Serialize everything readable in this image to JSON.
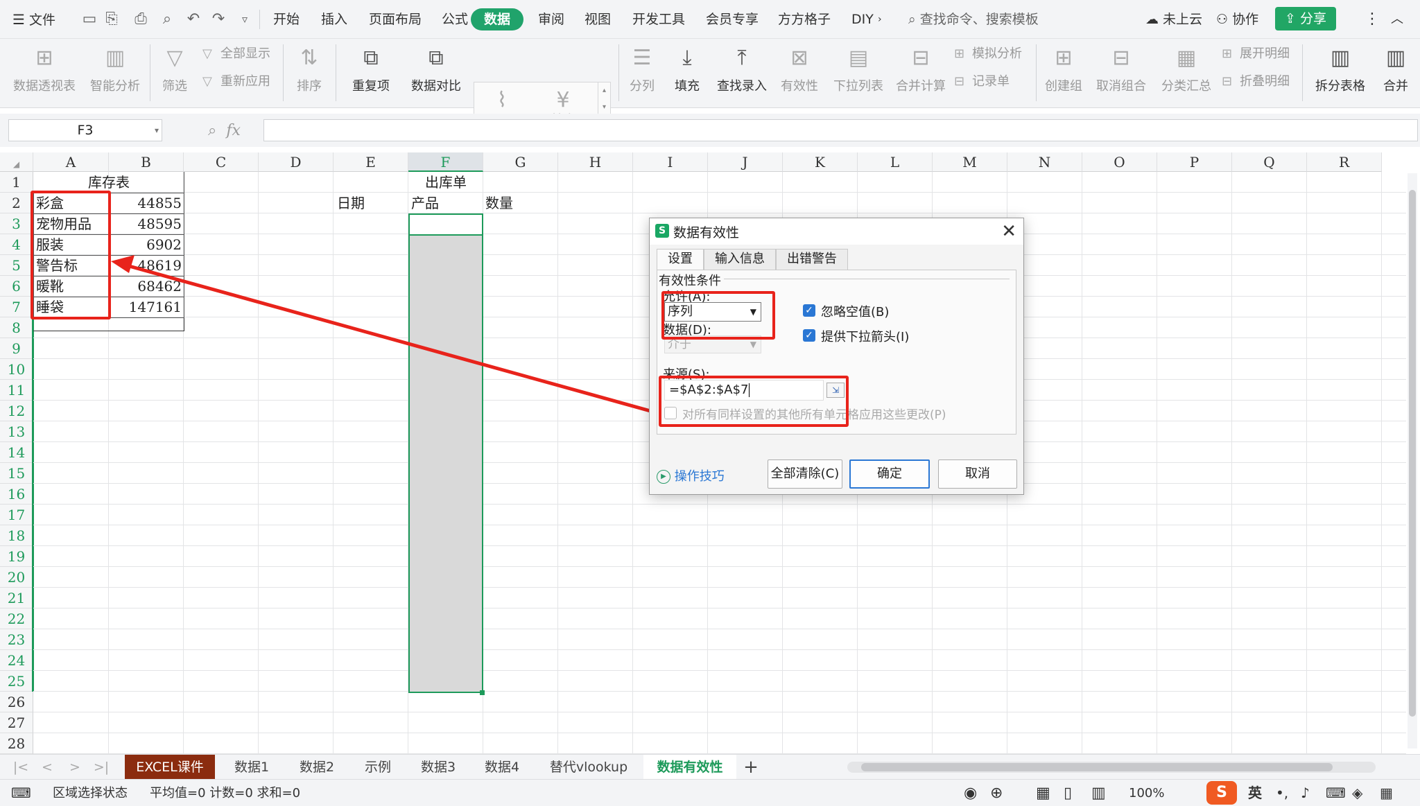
{
  "menubar": {
    "file": "文件",
    "tabs": [
      "开始",
      "插入",
      "页面布局",
      "公式",
      "数据",
      "审阅",
      "视图",
      "开发工具",
      "会员专享",
      "方方格子",
      "DIY"
    ],
    "active_tab": "数据",
    "search_placeholder": "查找命令、搜索模板",
    "cloud": "未上云",
    "collab": "协作",
    "share": "分享"
  },
  "ribbon": {
    "pivot": "数据透视表",
    "smart": "智能分析",
    "filter": "筛选",
    "show_all": "全部显示",
    "reapply": "重新应用",
    "sort": "排序",
    "duplicates": "重复项",
    "compare": "数据对比",
    "stock": "股票",
    "fund": "基金",
    "split": "分列",
    "fill": "填充",
    "lookup": "查找录入",
    "validity": "有效性",
    "dropdown": "下拉列表",
    "consolidate": "合并计算",
    "whatif": "模拟分析",
    "record": "记录单",
    "group": "创建组",
    "ungroup": "取消组合",
    "subtotal": "分类汇总",
    "expand": "展开明细",
    "collapse": "折叠明细",
    "split_table": "拆分表格",
    "merge": "合并"
  },
  "formula": {
    "namebox": "F3",
    "fx": "fx"
  },
  "grid": {
    "columns": [
      "A",
      "B",
      "C",
      "D",
      "E",
      "F",
      "G",
      "H",
      "I",
      "J",
      "K",
      "L",
      "M",
      "N",
      "O",
      "P",
      "Q",
      "R"
    ],
    "rows": [
      "1",
      "2",
      "3",
      "4",
      "5",
      "6",
      "7",
      "8",
      "9",
      "10",
      "11",
      "12",
      "13",
      "14",
      "15",
      "16",
      "17",
      "18",
      "19",
      "20",
      "21",
      "22",
      "23",
      "24",
      "25",
      "26",
      "27",
      "28"
    ],
    "inventory_title": "库存表",
    "outbound_title": "出库单",
    "header_date": "日期",
    "header_product": "产品",
    "header_qty": "数量",
    "inventory": [
      {
        "name": "彩盒",
        "qty": "44855"
      },
      {
        "name": "宠物用品",
        "qty": "48595"
      },
      {
        "name": "服装",
        "qty": "6902"
      },
      {
        "name": "警告标",
        "qty": "48619"
      },
      {
        "name": "暖靴",
        "qty": "68462"
      },
      {
        "name": "睡袋",
        "qty": "147161"
      }
    ]
  },
  "dialog": {
    "title": "数据有效性",
    "tabs": [
      "设置",
      "输入信息",
      "出错警告"
    ],
    "section": "有效性条件",
    "allow_label": "允许(A):",
    "allow_value": "序列",
    "data_label": "数据(D):",
    "data_value": "介于",
    "ignore_blank": "忽略空值(B)",
    "dropdown_arrow": "提供下拉箭头(I)",
    "source_label": "来源(S):",
    "source_value": "=$A$2:$A$7",
    "apply_all": "对所有同样设置的其他所有单元格应用这些更改(P)",
    "tips": "操作技巧",
    "clear_all": "全部清除(C)",
    "ok": "确定",
    "cancel": "取消"
  },
  "sheets": {
    "tabs": [
      "EXCEL课件",
      "数据1",
      "数据2",
      "示例",
      "数据3",
      "数据4",
      "替代vlookup",
      "数据有效性"
    ],
    "active": "数据有效性"
  },
  "status": {
    "mode": "区域选择状态",
    "stats": "平均值=0  计数=0  求和=0",
    "zoom": "100%",
    "ime": "英"
  },
  "colors": {
    "accent_green": "#20a36b",
    "highlight_red": "#e8231b",
    "active_sheet_tab": "#8b2c0f"
  }
}
